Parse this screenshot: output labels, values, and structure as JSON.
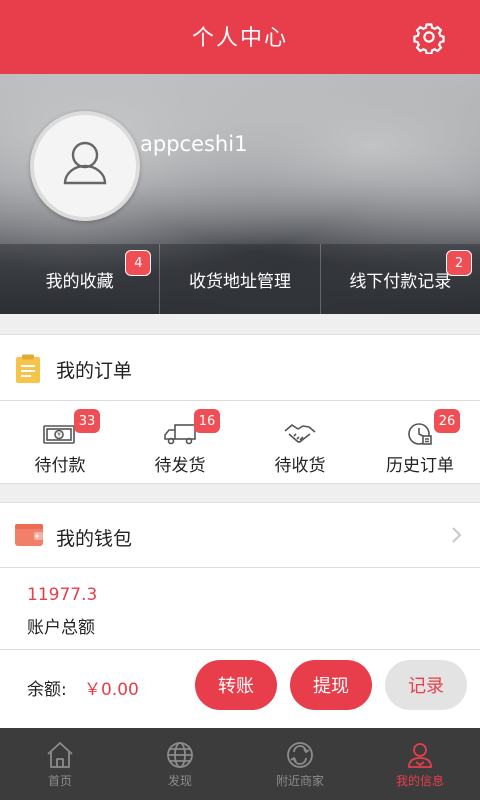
{
  "header": {
    "title": "个人中心",
    "settings_icon": "gear-icon"
  },
  "profile": {
    "username": "appceshi1",
    "avatar_icon": "user-avatar-icon",
    "stats": [
      {
        "label": "我的收藏",
        "badge": "4"
      },
      {
        "label": "收货地址管理",
        "badge": ""
      },
      {
        "label": "线下付款记录",
        "badge": "2"
      }
    ]
  },
  "orders": {
    "title": "我的订单",
    "icon": "clipboard-icon",
    "items": [
      {
        "label": "待付款",
        "badge": "33",
        "icon": "banknote-icon"
      },
      {
        "label": "待发货",
        "badge": "16",
        "icon": "truck-icon"
      },
      {
        "label": "待收货",
        "badge": "",
        "icon": "handshake-icon"
      },
      {
        "label": "历史订单",
        "badge": "26",
        "icon": "clock-icon"
      }
    ]
  },
  "wallet": {
    "title": "我的钱包",
    "icon": "wallet-icon",
    "total_amount": "11977.3",
    "total_label": "账户总额",
    "balance_label": "余额:",
    "balance_value": "￥0.00",
    "buttons": {
      "transfer": "转账",
      "withdraw": "提现",
      "records": "记录"
    }
  },
  "tabbar": {
    "tabs": [
      {
        "label": "首页",
        "icon": "home-icon"
      },
      {
        "label": "发现",
        "icon": "globe-icon"
      },
      {
        "label": "附近商家",
        "icon": "nearby-icon"
      },
      {
        "label": "我的信息",
        "icon": "profile-icon"
      }
    ],
    "active_index": 3
  },
  "colors": {
    "brand": "#e83e4c",
    "badge": "#f04e55",
    "tabbar": "#3c3c3c"
  }
}
